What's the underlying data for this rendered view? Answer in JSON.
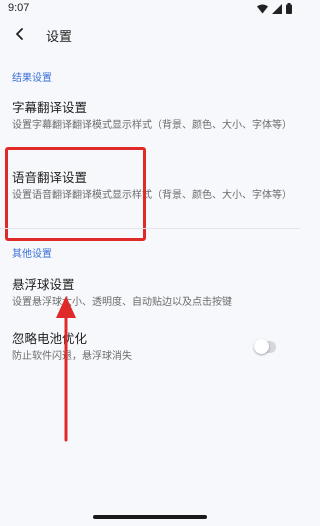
{
  "status_bar": {
    "time": "9:07",
    "icons": [
      "wifi-icon",
      "signal-icon",
      "battery-icon"
    ]
  },
  "toolbar": {
    "title": "设置"
  },
  "sections": {
    "results_header": "结果设置",
    "other_header": "其他设置"
  },
  "items": {
    "subtitle_translation": {
      "title": "字幕翻译设置",
      "desc": "设置字幕翻译翻译模式显示样式（背景、颜色、大小、字体等）"
    },
    "voice_translation": {
      "title": "语音翻译设置",
      "desc": "设置语音翻译翻译模式显示样式（背景、颜色、大小、字体等）"
    },
    "floating_ball": {
      "title": "悬浮球设置",
      "desc": "设置悬浮球大小、透明度、自动贴边以及点击按键"
    },
    "battery_optimization": {
      "title": "忽略电池优化",
      "desc": "防止软件闪退，悬浮球消失",
      "enabled": false
    }
  },
  "colors": {
    "accent": "#3a6fd8",
    "highlight": "#e02a2a",
    "background": "#f7f8fb"
  }
}
